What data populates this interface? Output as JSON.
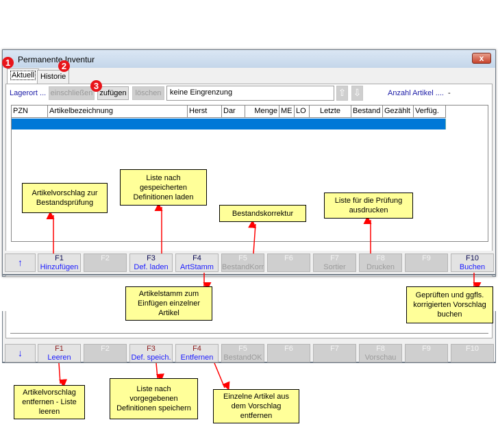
{
  "window": {
    "title": "Permanente Inventur",
    "close_label": "x"
  },
  "tabs": [
    {
      "label": "Aktuell",
      "active": true
    },
    {
      "label": "Historie",
      "active": false
    }
  ],
  "toolbar": {
    "lagerort": "Lagerort ...",
    "einschliessen": "einschließen",
    "zufuegen": "zufügen",
    "loeschen": "löschen",
    "filter_value": "keine Eingrenzung",
    "anzahl_label": "Anzahl Artikel ....",
    "anzahl_value": "-"
  },
  "table": {
    "columns": [
      "PZN",
      "Artikelbezeichnung",
      "Herst",
      "Dar",
      "Menge",
      "ME",
      "LO",
      "Letzte",
      "Bestand",
      "Gezählt",
      "Verfüg."
    ]
  },
  "upper_fkeys": [
    {
      "key": "F1",
      "label": "Hinzufügen",
      "enabled": true
    },
    {
      "key": "F2",
      "label": "",
      "enabled": false
    },
    {
      "key": "F3",
      "label": "Def. laden",
      "enabled": true
    },
    {
      "key": "F4",
      "label": "ArtStamm",
      "enabled": true
    },
    {
      "key": "F5",
      "label": "BestandKorr",
      "enabled": false
    },
    {
      "key": "F6",
      "label": "",
      "enabled": false
    },
    {
      "key": "F7",
      "label": "Sortier",
      "enabled": false
    },
    {
      "key": "F8",
      "label": "Drucken",
      "enabled": false
    },
    {
      "key": "F9",
      "label": "",
      "enabled": false
    },
    {
      "key": "F10",
      "label": "Buchen",
      "enabled": true
    }
  ],
  "lower_fkeys": [
    {
      "key": "F1",
      "label": "Leeren",
      "enabled": true
    },
    {
      "key": "F2",
      "label": "",
      "enabled": false
    },
    {
      "key": "F3",
      "label": "Def. speich.",
      "enabled": true
    },
    {
      "key": "F4",
      "label": "Entfernen",
      "enabled": true
    },
    {
      "key": "F5",
      "label": "BestandOK",
      "enabled": false
    },
    {
      "key": "F6",
      "label": "",
      "enabled": false
    },
    {
      "key": "F7",
      "label": "",
      "enabled": false
    },
    {
      "key": "F8",
      "label": "Vorschau",
      "enabled": false
    },
    {
      "key": "F9",
      "label": "",
      "enabled": false
    },
    {
      "key": "F10",
      "label": "",
      "enabled": false
    }
  ],
  "markers": [
    "1",
    "2",
    "3"
  ],
  "callouts": {
    "c1": "Artikelvorschlag zur Bestandsprüfung",
    "c2": "Liste nach gespeicherten Definitionen laden",
    "c3": "Bestandskorrektur",
    "c4": "Liste für die Prüfung ausdrucken",
    "c5": "Artikelstamm zum Einfügen einzelner Artikel",
    "c6": "Geprüften und ggfls. korrigierten Vorschlag buchen",
    "c7": "Artikelvorschlag entfernen - Liste leeren",
    "c8": "Liste nach vorgegebenen Definitionen speichern",
    "c9": "Einzelne Artikel aus dem Vorschlag entfernen"
  },
  "colors": {
    "selection": "#0078d7",
    "callout_bg": "#ffff99",
    "arrow": "#ff0000",
    "marker": "#e8141a"
  }
}
